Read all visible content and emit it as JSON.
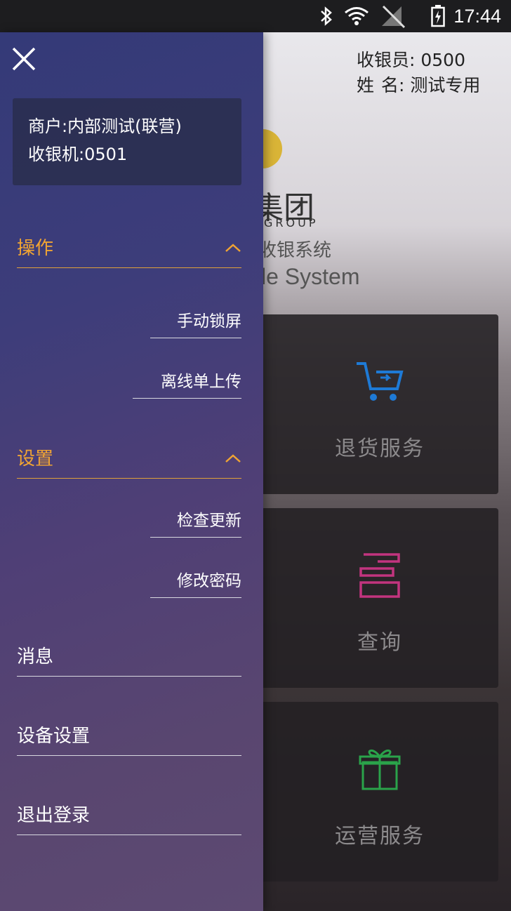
{
  "status_bar": {
    "icons": [
      "bluetooth-icon",
      "wifi-icon",
      "no-signal-icon",
      "battery-charging-icon"
    ],
    "time": "17:44"
  },
  "background": {
    "cashier_label": "收银员: 0500",
    "name_label": "姓",
    "name_value": "名: 测试专用",
    "logo_cn": "集团",
    "logo_group": "GROUP",
    "logo_sub": "收银系统",
    "logo_en": "le System",
    "tiles": [
      {
        "label": "退货服务",
        "icon": "shopping-cart-return-icon",
        "icon_color": "#1e7ad6"
      },
      {
        "label": "查询",
        "icon": "list-query-icon",
        "icon_color": "#c2347f"
      },
      {
        "label": "运营服务",
        "icon": "gift-box-icon",
        "icon_color": "#2aa34a"
      }
    ]
  },
  "drawer": {
    "close_icon": "close-icon",
    "merchant": "商户:内部测试(联营)",
    "terminal": "收银机:0501",
    "sections": [
      {
        "label": "操作",
        "items": [
          "手动锁屏",
          "离线单上传"
        ]
      },
      {
        "label": "设置",
        "items": [
          "检查更新",
          "修改密码"
        ]
      }
    ],
    "menu_items": [
      "消息",
      "设备设置",
      "退出登录"
    ],
    "accent_color": "#f0a433"
  }
}
